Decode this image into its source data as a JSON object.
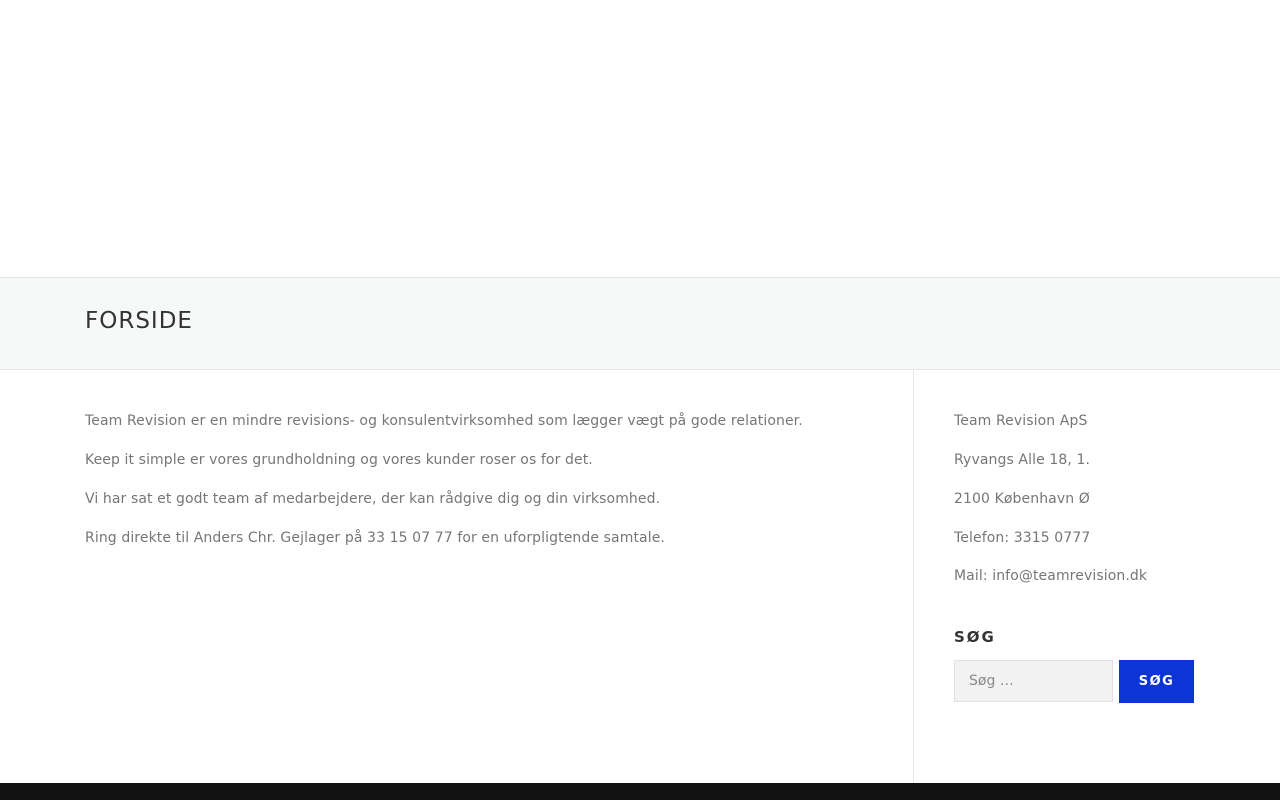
{
  "page": {
    "title": "FORSIDE"
  },
  "main": {
    "paragraphs": [
      "Team Revision er en mindre revisions- og konsulentvirksomhed som lægger vægt på gode relationer.",
      "Keep it simple er vores grundholdning og vores kunder roser os for det.",
      "Vi har sat et godt team af medarbejdere, der kan rådgive dig og din virksomhed.",
      "Ring direkte til Anders Chr. Gejlager på 33 15 07 77 for en uforpligtende samtale."
    ]
  },
  "sidebar": {
    "contact": {
      "company": "Team Revision ApS",
      "street": "Ryvangs Alle 18, 1.",
      "city": "2100 København Ø",
      "phone": "Telefon:  3315 0777",
      "mail": "Mail:  info@teamrevision.dk"
    },
    "search": {
      "title": "SØG",
      "placeholder": "Søg …",
      "button_label": "SØG"
    }
  },
  "colors": {
    "accent": "#0d34d4",
    "title_bar_bg": "#f7f8f8",
    "footer_bg": "#111111",
    "text": "#767676",
    "heading": "#333333"
  }
}
